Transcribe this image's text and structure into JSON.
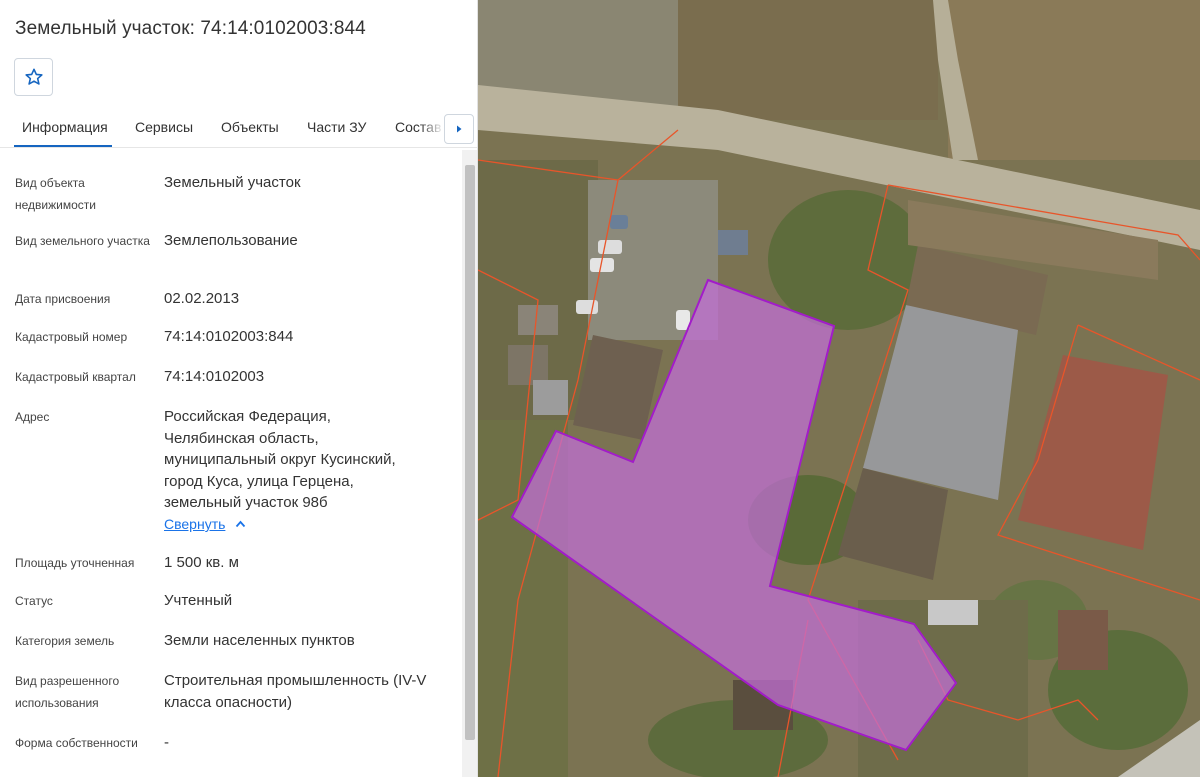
{
  "header": {
    "title": "Земельный участок: 74:14:0102003:844"
  },
  "tabs": [
    {
      "label": "Информация",
      "active": true
    },
    {
      "label": "Сервисы",
      "active": false
    },
    {
      "label": "Объекты",
      "active": false
    },
    {
      "label": "Части ЗУ",
      "active": false
    },
    {
      "label": "Состав",
      "active": false
    }
  ],
  "info": {
    "object_type": {
      "label": "Вид объекта недвижимости",
      "value": "Земельный участок"
    },
    "land_type": {
      "label": "Вид земельного участка",
      "value": "Землепользование"
    },
    "assigned_date": {
      "label": "Дата присвоения",
      "value": "02.02.2013"
    },
    "cadastral_number": {
      "label": "Кадастровый номер",
      "value": "74:14:0102003:844"
    },
    "cadastral_quarter": {
      "label": "Кадастровый квартал",
      "value": "74:14:0102003"
    },
    "address": {
      "label": "Адрес",
      "lines": [
        "Российская Федерация,",
        "Челябинская область,",
        "муниципальный округ Кусинский,",
        "город Куса, улица Герцена,",
        "земельный участок 98б"
      ],
      "collapse_label": "Свернуть"
    },
    "area": {
      "label": "Площадь уточненная",
      "value": "1 500 кв. м"
    },
    "status": {
      "label": "Статус",
      "value": "Учтенный"
    },
    "land_category": {
      "label": "Категория земель",
      "value": "Земли населенных пунктов"
    },
    "permitted_use": {
      "label": "Вид разрешенного использования",
      "value": "Строительная промышленность (IV-V класса опасности)"
    },
    "ownership": {
      "label": "Форма собственности",
      "value": "-"
    }
  },
  "colors": {
    "accent": "#1565c0",
    "link": "#1a73e8",
    "parcel_fill": "#c36fd8",
    "parcel_stroke": "#a21cc9",
    "boundary": "#e8552a"
  },
  "icons": {
    "favorite": "star-outline-icon",
    "tabs_next": "chevron-right-icon",
    "collapse": "chevron-up-icon"
  }
}
